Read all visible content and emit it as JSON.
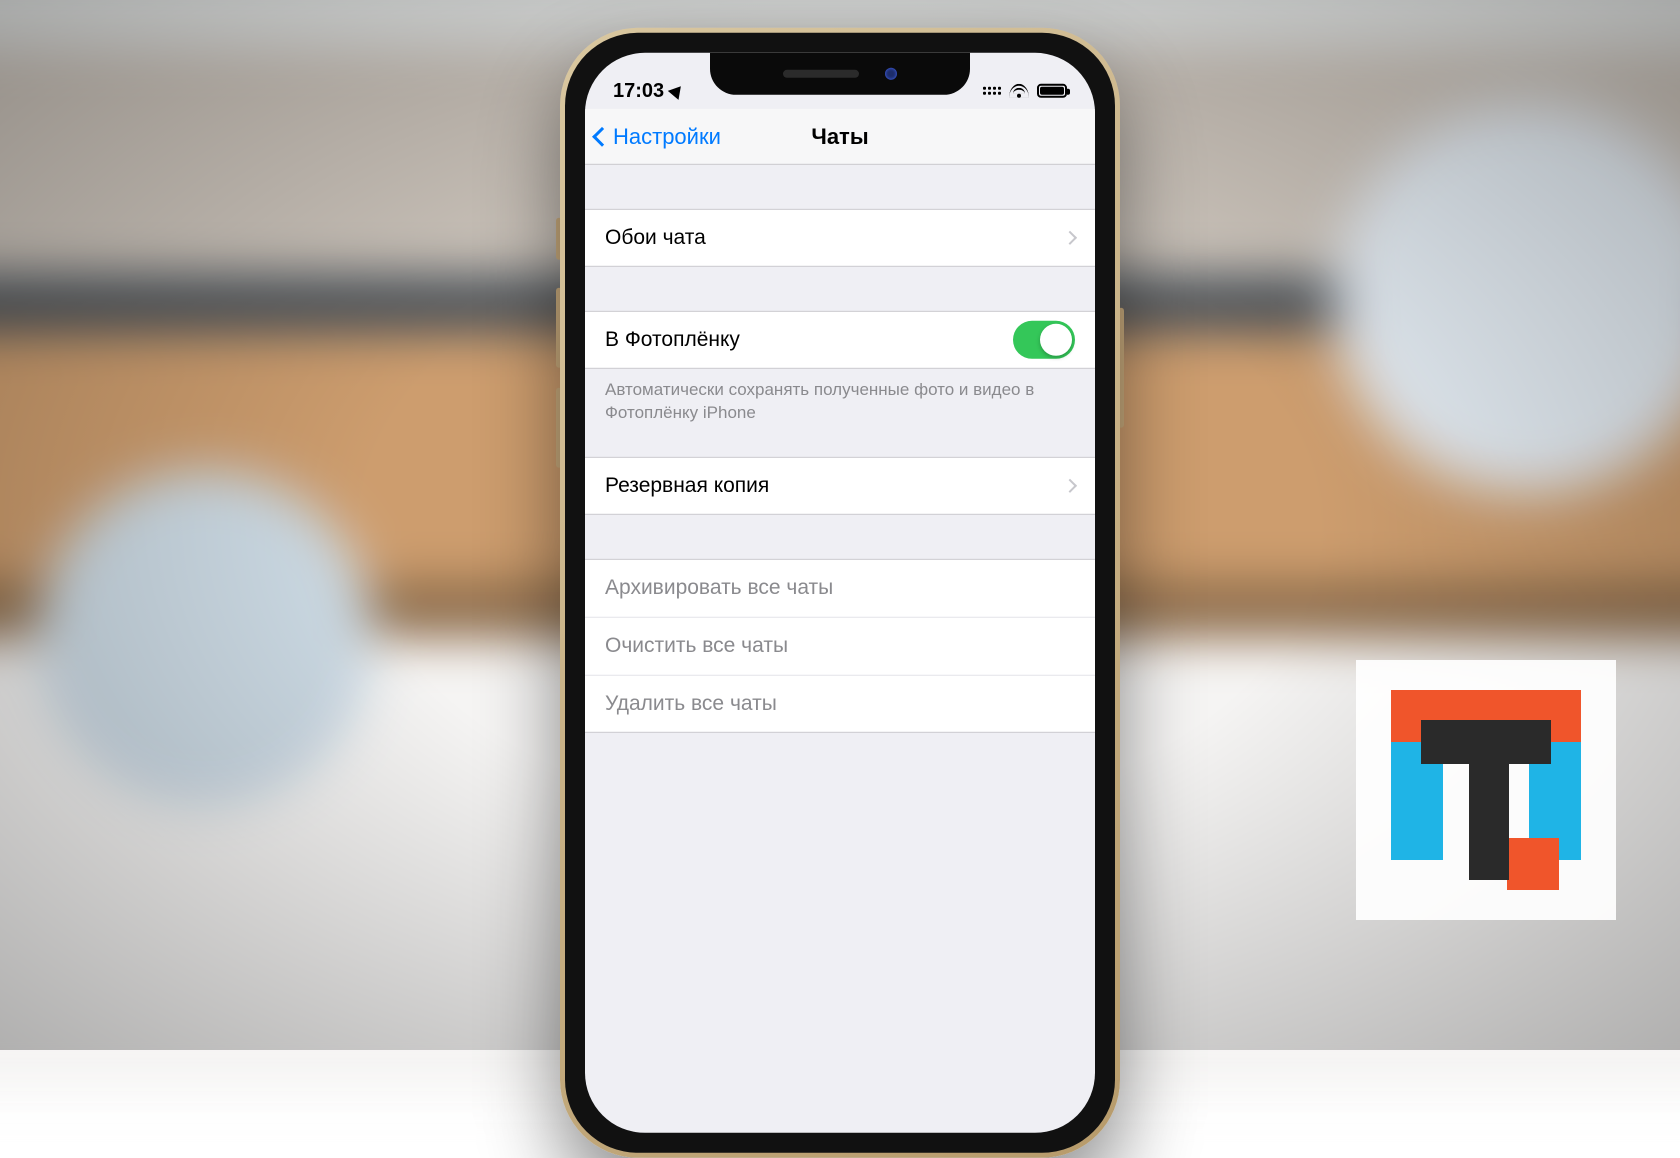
{
  "status": {
    "time": "17:03",
    "location_icon": "location-arrow",
    "signal_icon": "dual-sim-signal",
    "wifi_icon": "wifi",
    "battery_icon": "battery-full"
  },
  "nav": {
    "back_label": "Настройки",
    "title": "Чаты"
  },
  "groups": {
    "wallpaper": {
      "label": "Обои чата"
    },
    "camera_roll": {
      "label": "В Фотоплёнку",
      "toggle_on": true,
      "footer": "Автоматически сохранять полученные фото и видео в Фотоплёнку iPhone"
    },
    "backup": {
      "label": "Резервная копия"
    },
    "actions": {
      "archive": "Архивировать все чаты",
      "clear": "Очистить все чаты",
      "delete": "Удалить все чаты"
    }
  },
  "colors": {
    "ios_blue": "#007aff",
    "ios_green": "#34c759",
    "accent_orange": "#f0552b",
    "accent_cyan": "#1fb4e6"
  }
}
